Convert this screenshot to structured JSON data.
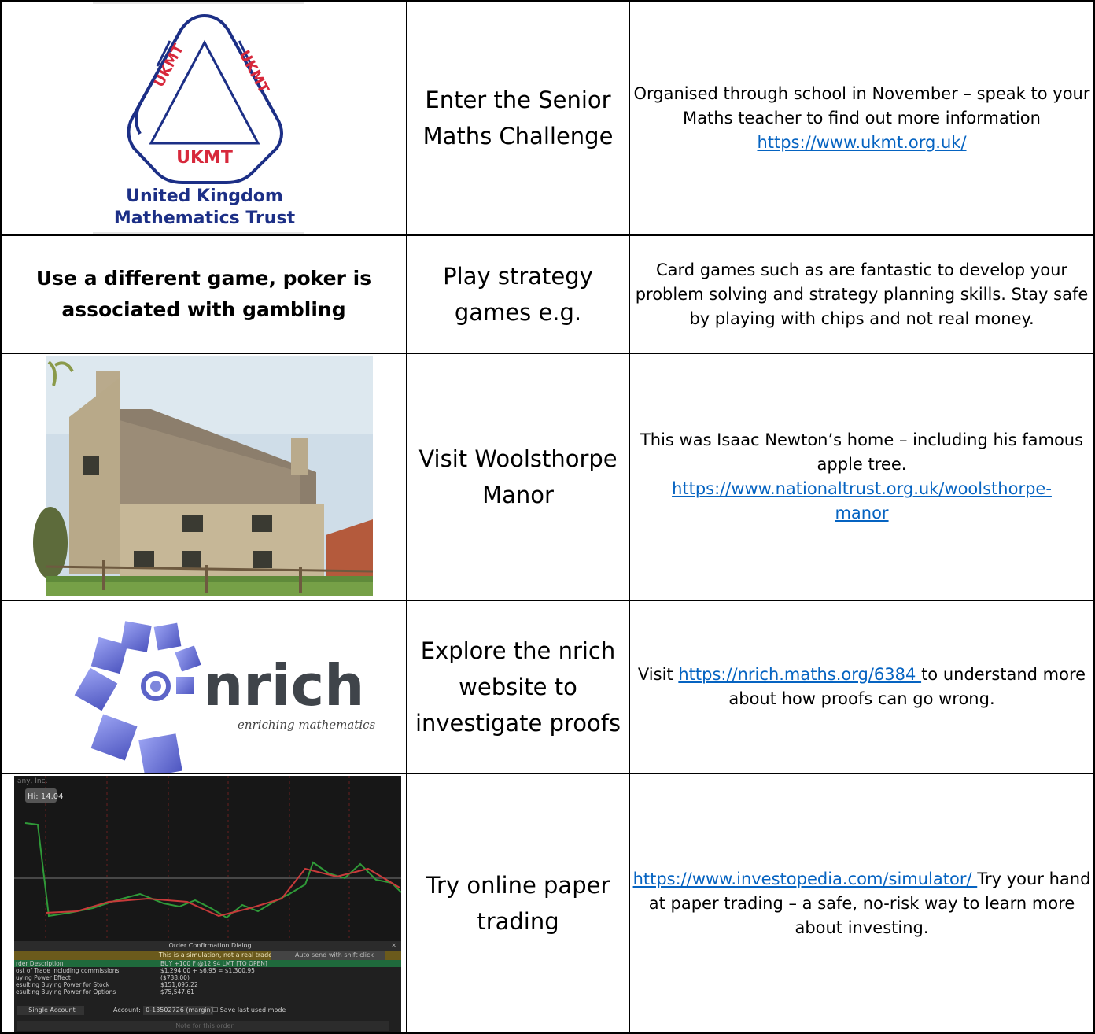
{
  "rows": [
    {
      "logo": {
        "org_line1": "United Kingdom",
        "org_line2": "Mathematics Trust",
        "badge": "UKMT",
        "side_text": "UKMT"
      },
      "activity": "Enter the Senior Maths Challenge",
      "desc": "Organised through school in November – speak to your Maths teacher to find out more information",
      "link": "https://www.ukmt.org.uk/"
    },
    {
      "left_text": "Use a different game, poker is associated with gambling",
      "activity": "Play strategy games e.g.",
      "desc": "Card games such as are fantastic to develop your problem solving and strategy planning skills. Stay safe by playing with chips and not real money."
    },
    {
      "activity": "Visit Woolsthorpe Manor",
      "desc": "This was Isaac Newton’s home – including his famous apple tree.",
      "link_a": "https://www.nationaltrust.org.uk/woolsthorpe-",
      "link_b": "manor"
    },
    {
      "logo": {
        "word": "nrich",
        "tagline": "enriching mathematics"
      },
      "activity": "Explore the nrich website to investigate proofs",
      "desc_prefix": "Visit ",
      "link": "https://nrich.maths.org/6384 ",
      "desc_suffix": "to understand more about how proofs can go wrong."
    },
    {
      "chart": {
        "hi_label": "Hi: 14.04",
        "company": "any, Inc.",
        "dialog_title": "Order Confirmation Dialog",
        "sim_notice": "This is a simulation, not a real trade",
        "auto_send": "Auto send with shift click",
        "rows": [
          {
            "label": "rder Description",
            "value": "BUY +100 F @12.94 LMT [TO OPEN]"
          },
          {
            "label": "ost of Trade including commissions",
            "value": "$1,294.00 + $6.95 = $1,300.95"
          },
          {
            "label": "uying Power Effect",
            "value": "($738.00)"
          },
          {
            "label": "esulting Buying Power for Stock",
            "value": "$151,095.22"
          },
          {
            "label": "esulting Buying Power for Options",
            "value": "$75,547.61"
          }
        ],
        "account_select": "Single Account",
        "account_label": "Account:",
        "account_value": "0-13502726 (margin)",
        "save_mode": "Save last used mode",
        "note_placeholder": "Note for this order"
      },
      "activity": "Try online paper trading",
      "link": "https://www.investopedia.com/simulator/ ",
      "desc": "Try your hand at paper trading – a safe, no-risk way to learn more about investing."
    }
  ]
}
